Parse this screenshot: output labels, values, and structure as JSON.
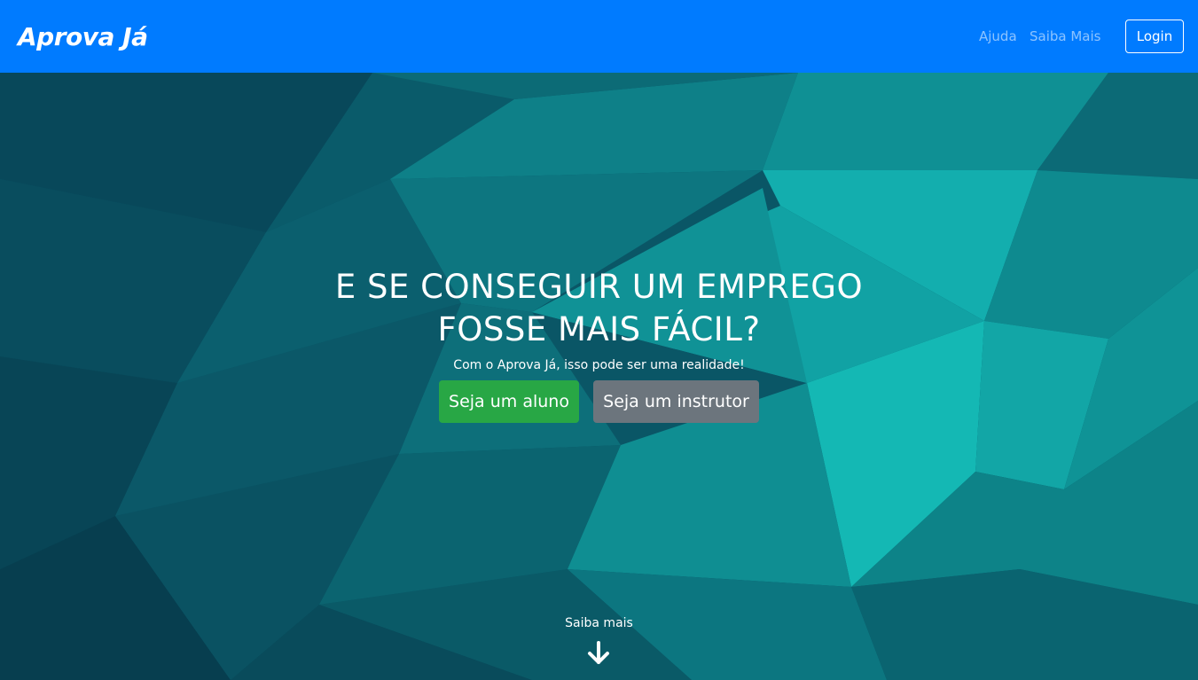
{
  "navbar": {
    "brand": "Aprova Já",
    "links": [
      "Ajuda",
      "Saiba Mais"
    ],
    "login_label": "Login",
    "background": "#007bff"
  },
  "hero": {
    "headline_line1": "E SE CONSEGUIR UM EMPREGO",
    "headline_line2": "FOSSE MAIS FÁCIL?",
    "subtitle": "Com o Aprova Já, isso pode ser uma realidade!",
    "student_button": "Seja um aluno",
    "instructor_button": "Seja um instrutor",
    "scroll_label": "Saiba mais",
    "scroll_icon": "arrow-down-icon",
    "colors": {
      "student_button": "#28a745",
      "instructor_button": "#6c757d",
      "background": "#0a5666"
    }
  }
}
